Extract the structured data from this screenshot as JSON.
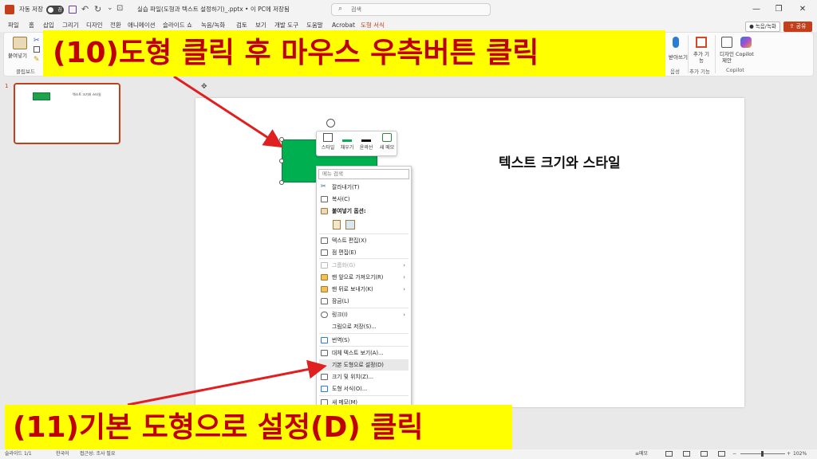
{
  "titlebar": {
    "autosave_label": "자동 저장",
    "autosave_state": "끔",
    "filename": "실습 파일(도형과 텍스트 설정하기)_.pptx • 이 PC에 저장됨",
    "search_placeholder": "검색",
    "minimize": "—",
    "restore": "❐",
    "close": "✕"
  },
  "menu": {
    "tabs": [
      "파일",
      "홈",
      "삽입",
      "그리기",
      "디자인",
      "전환",
      "애니메이션",
      "슬라이드 쇼",
      "녹음/녹화",
      "검토",
      "보기",
      "개발 도구",
      "도움말",
      "Acrobat",
      "도형 서식"
    ],
    "record_label": "● 녹음/녹화",
    "share_label": "⇪ 공유"
  },
  "ribbon": {
    "paste_label": "붙여넣기",
    "clipboard_group": "클립보드",
    "dictate_label": "받아쓰기",
    "voice_group": "음성",
    "addin_label": "추가 기능",
    "addin_group": "추가 기능",
    "designer_label": "디자인 제안",
    "copilot_label": "Copilot",
    "copilot_group": "Copilot"
  },
  "thumbnail": {
    "slide_number": "1",
    "text": "텍스트 크기와 스타일"
  },
  "slide": {
    "title": "텍스트 크기와 스타일"
  },
  "minibar": {
    "style": "스타일",
    "fill": "채우기",
    "outline": "윤곽선",
    "new_comment": "새 메모"
  },
  "context_menu": {
    "search_placeholder": "메뉴 검색",
    "cut": "잘라내기(T)",
    "copy": "복사(C)",
    "paste_options": "붙여넣기 옵션:",
    "edit_text": "텍스트 편집(X)",
    "edit_points": "점 편집(E)",
    "group": "그룹화(G)",
    "bring_front": "맨 앞으로 가져오기(R)",
    "send_back": "맨 뒤로 보내기(K)",
    "lock": "잠금(L)",
    "link": "링크(I)",
    "save_as_picture": "그림으로 저장(S)...",
    "translate": "번역(S)",
    "view_alt_text": "대체 텍스트 보기(A)...",
    "set_default_shape": "기본 도형으로 설정(D)",
    "size_position": "크기 및 위치(Z)...",
    "format_shape": "도형 서식(O)...",
    "new_comment": "새 메모(M)"
  },
  "annotations": {
    "step10": "(10)도형 클릭 후 마우스 우측버튼 클릭",
    "step11": "(11)기본 도형으로 설정(D) 클릭"
  },
  "statusbar": {
    "slide_info": "슬라이드 1/1",
    "language": "한국어",
    "accessibility": "접근성: 조사 필요",
    "notes": "≡메모",
    "zoom": "102%"
  },
  "colors": {
    "accent": "#c43e1c",
    "shape_fill": "#00b050",
    "banner_bg": "#ffff00",
    "banner_text": "#c00000",
    "arrow": "#e02020"
  }
}
